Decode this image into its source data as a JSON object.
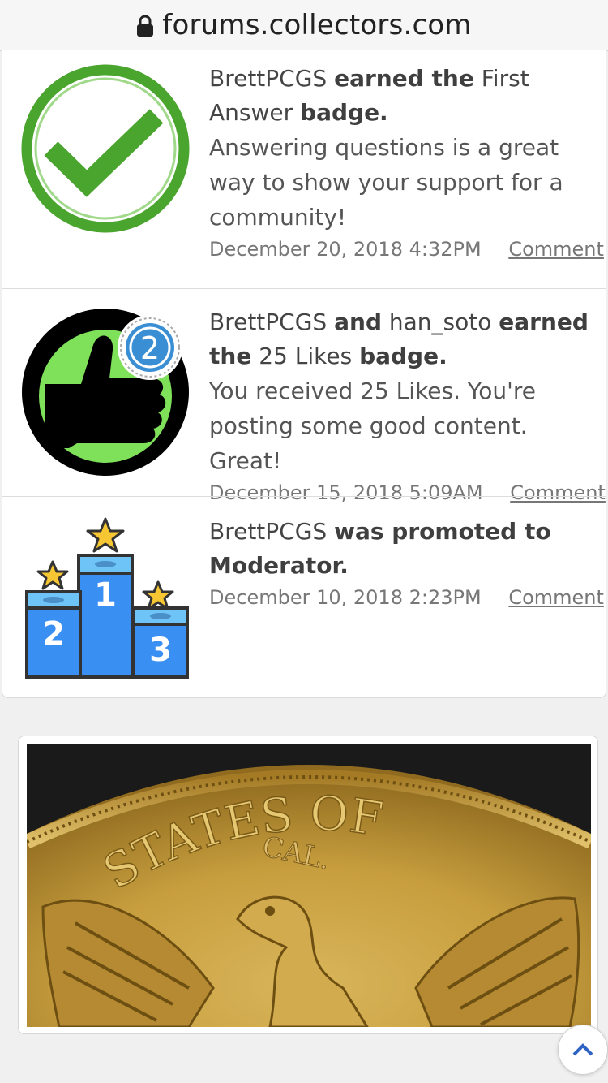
{
  "browser": {
    "url": "forums.collectors.com"
  },
  "feed": [
    {
      "user": "BrettPCGS",
      "verb": "earned the",
      "badge_name": "First Answer",
      "suffix": "badge.",
      "description": "Answering questions is a great way to show your support for a community!",
      "date": "December 20, 2018 4:32PM",
      "comment": "Comment",
      "icon": "check-circle-icon"
    },
    {
      "user": "BrettPCGS",
      "conj": "and",
      "user2": "han_soto",
      "verb": "earned",
      "the": "the",
      "badge_name": "25 Likes",
      "suffix": "badge.",
      "description": "You received 25 Likes. You're posting some good content. Great!",
      "date": "December 15, 2018 5:09AM",
      "comment": "Comment",
      "icon": "thumbs-up-icon",
      "badge_level": "2"
    },
    {
      "user": "BrettPCGS",
      "verb": "was promoted to",
      "role": "Moderator.",
      "date": "December 10, 2018 2:23PM",
      "comment": "Comment",
      "icon": "podium-icon",
      "podium": [
        "1",
        "2",
        "3"
      ]
    }
  ],
  "coin_image": {
    "icon": "gold-coin-photo",
    "legend_top": "STATES OF",
    "legend_small": "CAL."
  },
  "scroll_top": {
    "icon": "chevron-up-icon"
  },
  "colors": {
    "check_green": "#4aa52e",
    "likes_green": "#7fe05a",
    "podium_blue": "#3a8ff2",
    "star_yellow": "#f6c633"
  }
}
